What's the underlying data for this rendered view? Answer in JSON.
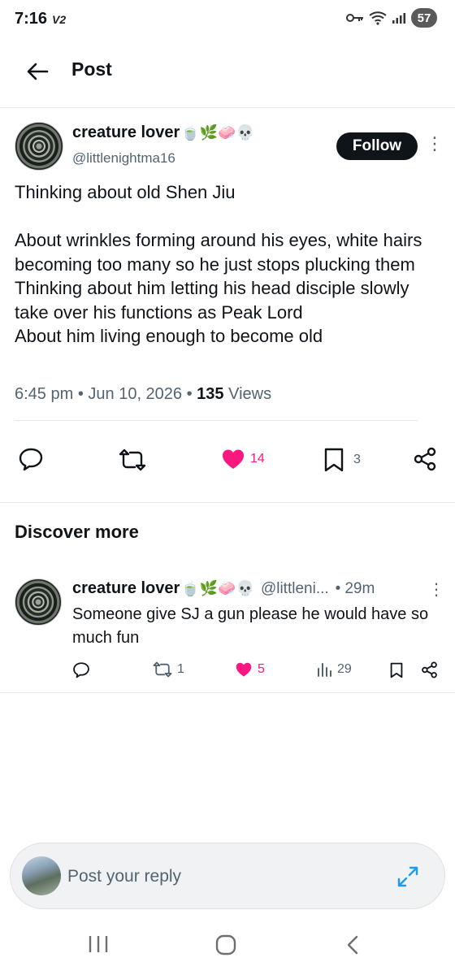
{
  "status_bar": {
    "time": "7:16",
    "carrier_badge": "V2",
    "battery": "57"
  },
  "header": {
    "title": "Post"
  },
  "tweet": {
    "author_name": "creature lover",
    "author_emojis": "🍵🌿🧼💀",
    "handle": "@littlenightma16",
    "follow_label": "Follow",
    "text": "Thinking about old Shen Jiu\n\nAbout wrinkles forming around his eyes, white hairs becoming too many so he just stops plucking them\nThinking about him letting his head disciple slowly take over his functions as Peak Lord\nAbout him living enough to become old",
    "time": "6:45 pm",
    "date": "Jun 10, 2026",
    "views_count": "135",
    "views_label": "Views",
    "likes": "14",
    "bookmarks": "3"
  },
  "discover": {
    "title": "Discover more",
    "post": {
      "author_name": "creature lover",
      "author_emojis": "🍵🌿🧼💀",
      "handle": "@littleni...",
      "age": "29m",
      "text": "Someone give SJ a gun please he would have so much fun",
      "retweets": "1",
      "likes": "5",
      "views": "29"
    }
  },
  "reply": {
    "placeholder": "Post your reply"
  },
  "colors": {
    "like": "#f91880",
    "text": "#0f1419",
    "muted": "#536471"
  }
}
